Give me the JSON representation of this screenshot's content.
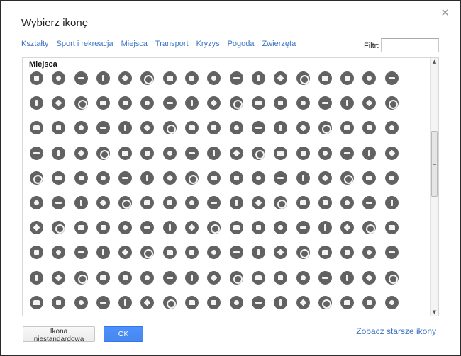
{
  "dialog": {
    "title": "Wybierz ikonę",
    "close_glyph": "✕"
  },
  "tabs": [
    {
      "label": "Kształty"
    },
    {
      "label": "Sport i rekreacja"
    },
    {
      "label": "Miejsca"
    },
    {
      "label": "Transport"
    },
    {
      "label": "Kryzys"
    },
    {
      "label": "Pogoda"
    },
    {
      "label": "Zwierzęta"
    }
  ],
  "filter": {
    "label": "Filtr:",
    "value": "",
    "placeholder": ""
  },
  "section": {
    "title": "Miejsca",
    "icon_rows": 10,
    "icon_cols": 17,
    "icon_color": "#626262"
  },
  "icon_names": [
    "restaurant-icon",
    "fast-food-icon",
    "burger-icon",
    "sandwich-icon",
    "pizza-icon",
    "noodles-icon",
    "coffee-cup-icon",
    "cow-icon",
    "chicken-icon",
    "fish-icon",
    "ice-cream-icon",
    "cocktail-icon",
    "shop-icon",
    "beer-icon",
    "wine-icon",
    "cafe-icon",
    "bag-icon",
    "mail-icon",
    "kiosk-icon",
    "shopping-cart-icon",
    "pharmacy-icon",
    "shoe-icon",
    "clothes-hanger-icon",
    "jewelry-icon",
    "flower-icon",
    "bakery-icon",
    "gift-icon",
    "tailor-icon",
    "phone-icon",
    "at-sign-icon",
    "wifi-icon",
    "laptop-icon",
    "tv-icon",
    "book-icon",
    "bank-icon",
    "atm-icon",
    "cash-icon",
    "stocks-icon",
    "dollar-icon",
    "credit-card-icon",
    "euro-icon",
    "pound-icon",
    "won-icon",
    "yen-icon",
    "flag-icon",
    "speech-icon",
    "casino-icon",
    "picnic-icon",
    "film-icon",
    "battery-icon",
    "gas-icon",
    "ticket-icon",
    "dice-icon",
    "sun-icon",
    "elephant-icon",
    "piano-icon",
    "music-note-icon",
    "bowling-icon",
    "microphone-icon",
    "mustache-icon",
    "xxx-icon",
    "tower-icon",
    "palette-icon",
    "accessible-icon",
    "parking-icon",
    "picnic-table-icon",
    "playground-icon",
    "tree-icon",
    "binoculars-icon",
    "camera-icon",
    "video-icon",
    "exit-icon",
    "calendar-icon",
    "bus-stop-icon",
    "shoe-print-icon",
    "road-icon",
    "hiking-icon",
    "arrow-down-left-icon",
    "arrows-cross-icon",
    "wheelchair-icon",
    "crutch-icon",
    "bed-icon",
    "printer-icon",
    "hand-icon",
    "phone-call-icon",
    "fire-hydrant-icon",
    "recycle-icon",
    "no-smoking-icon",
    "smoking-icon",
    "restrooms-icon",
    "female-icon",
    "male-icon",
    "lab-icon",
    "hairdresser-icon",
    "stroller-icon",
    "mouse-icon",
    "first-aid-icon",
    "heart-icon",
    "bathtub-icon",
    "anchor-icon",
    "luggage-icon",
    "lighthouse-icon",
    "fountain-icon",
    "dog-icon",
    "horse-icon",
    "statue-icon",
    "monument-icon",
    "pavilion-icon",
    "cross-grave-icon",
    "candle-icon",
    "pagoda-icon",
    "museum-icon",
    "castle-icon",
    "barn-icon",
    "star-tower-icon",
    "windmill-icon",
    "radio-icon",
    "sparkle-icon",
    "garden-icon",
    "home-icon",
    "bed-hotel-icon",
    "building-icon",
    "moon-icon",
    "envelope-icon",
    "torii-icon",
    "tickets-icon",
    "gas-pump-icon",
    "car-wash-icon",
    "car-icon",
    "heart-plus-icon",
    "scissors-icon",
    "skate-icon",
    "id-card-icon",
    "phone-booth-icon",
    "tools-t-icon",
    "wrench-icon",
    "plane-icon",
    "plug-icon",
    "faucet-icon",
    "briefcase-icon",
    "lock-icon",
    "family-icon",
    "graduation-icon",
    "school-icon",
    "person-icon",
    "library-icon",
    "stadium-icon",
    "tooth-icon",
    "eye-icon",
    "archery-icon",
    "waves-icon",
    "info-icon",
    "tree-house-icon",
    "buddha-icon",
    "teacher-icon",
    "gear-icon",
    "yin-wind-icon",
    "wheel-icon",
    "ring-icon",
    "christian-cross-icon",
    "om-icon",
    "crescent-icon",
    "shinto-icon",
    "star-of-david-icon",
    "globe-icon",
    "torii-gate-icon",
    "temple-icon",
    "church-icon",
    "mosque-icon",
    "dinosaur-icon"
  ],
  "buttons": {
    "custom_label": "Ikona niestandardowa",
    "ok_label": "OK"
  },
  "links": {
    "older_icons": "Zobacz starsze ikony"
  },
  "scrollbar": {
    "up_glyph": "▲",
    "down_glyph": "▼"
  }
}
